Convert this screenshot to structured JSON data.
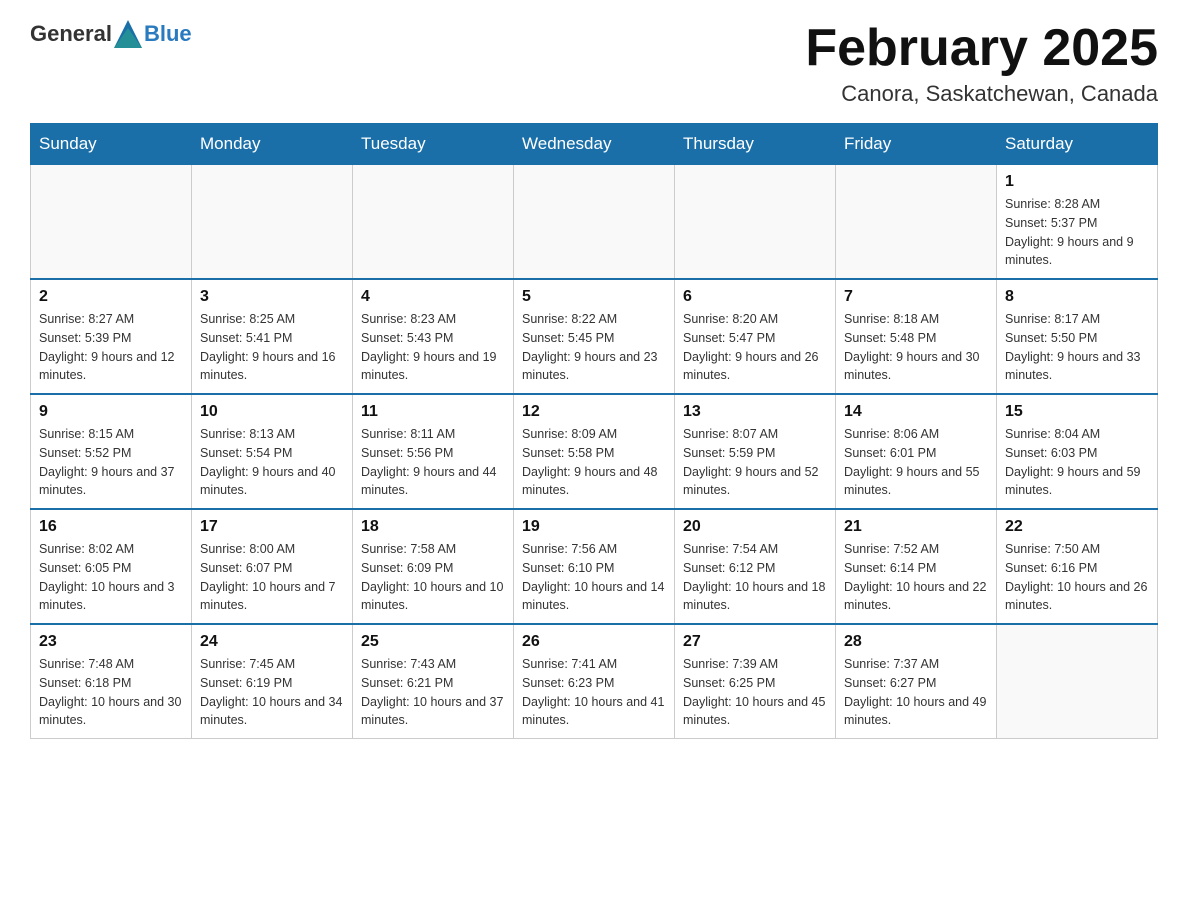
{
  "header": {
    "logo_text_general": "General",
    "logo_text_blue": "Blue",
    "month_title": "February 2025",
    "location": "Canora, Saskatchewan, Canada"
  },
  "days_of_week": [
    "Sunday",
    "Monday",
    "Tuesday",
    "Wednesday",
    "Thursday",
    "Friday",
    "Saturday"
  ],
  "weeks": [
    [
      {
        "day": "",
        "info": ""
      },
      {
        "day": "",
        "info": ""
      },
      {
        "day": "",
        "info": ""
      },
      {
        "day": "",
        "info": ""
      },
      {
        "day": "",
        "info": ""
      },
      {
        "day": "",
        "info": ""
      },
      {
        "day": "1",
        "info": "Sunrise: 8:28 AM\nSunset: 5:37 PM\nDaylight: 9 hours and 9 minutes."
      }
    ],
    [
      {
        "day": "2",
        "info": "Sunrise: 8:27 AM\nSunset: 5:39 PM\nDaylight: 9 hours and 12 minutes."
      },
      {
        "day": "3",
        "info": "Sunrise: 8:25 AM\nSunset: 5:41 PM\nDaylight: 9 hours and 16 minutes."
      },
      {
        "day": "4",
        "info": "Sunrise: 8:23 AM\nSunset: 5:43 PM\nDaylight: 9 hours and 19 minutes."
      },
      {
        "day": "5",
        "info": "Sunrise: 8:22 AM\nSunset: 5:45 PM\nDaylight: 9 hours and 23 minutes."
      },
      {
        "day": "6",
        "info": "Sunrise: 8:20 AM\nSunset: 5:47 PM\nDaylight: 9 hours and 26 minutes."
      },
      {
        "day": "7",
        "info": "Sunrise: 8:18 AM\nSunset: 5:48 PM\nDaylight: 9 hours and 30 minutes."
      },
      {
        "day": "8",
        "info": "Sunrise: 8:17 AM\nSunset: 5:50 PM\nDaylight: 9 hours and 33 minutes."
      }
    ],
    [
      {
        "day": "9",
        "info": "Sunrise: 8:15 AM\nSunset: 5:52 PM\nDaylight: 9 hours and 37 minutes."
      },
      {
        "day": "10",
        "info": "Sunrise: 8:13 AM\nSunset: 5:54 PM\nDaylight: 9 hours and 40 minutes."
      },
      {
        "day": "11",
        "info": "Sunrise: 8:11 AM\nSunset: 5:56 PM\nDaylight: 9 hours and 44 minutes."
      },
      {
        "day": "12",
        "info": "Sunrise: 8:09 AM\nSunset: 5:58 PM\nDaylight: 9 hours and 48 minutes."
      },
      {
        "day": "13",
        "info": "Sunrise: 8:07 AM\nSunset: 5:59 PM\nDaylight: 9 hours and 52 minutes."
      },
      {
        "day": "14",
        "info": "Sunrise: 8:06 AM\nSunset: 6:01 PM\nDaylight: 9 hours and 55 minutes."
      },
      {
        "day": "15",
        "info": "Sunrise: 8:04 AM\nSunset: 6:03 PM\nDaylight: 9 hours and 59 minutes."
      }
    ],
    [
      {
        "day": "16",
        "info": "Sunrise: 8:02 AM\nSunset: 6:05 PM\nDaylight: 10 hours and 3 minutes."
      },
      {
        "day": "17",
        "info": "Sunrise: 8:00 AM\nSunset: 6:07 PM\nDaylight: 10 hours and 7 minutes."
      },
      {
        "day": "18",
        "info": "Sunrise: 7:58 AM\nSunset: 6:09 PM\nDaylight: 10 hours and 10 minutes."
      },
      {
        "day": "19",
        "info": "Sunrise: 7:56 AM\nSunset: 6:10 PM\nDaylight: 10 hours and 14 minutes."
      },
      {
        "day": "20",
        "info": "Sunrise: 7:54 AM\nSunset: 6:12 PM\nDaylight: 10 hours and 18 minutes."
      },
      {
        "day": "21",
        "info": "Sunrise: 7:52 AM\nSunset: 6:14 PM\nDaylight: 10 hours and 22 minutes."
      },
      {
        "day": "22",
        "info": "Sunrise: 7:50 AM\nSunset: 6:16 PM\nDaylight: 10 hours and 26 minutes."
      }
    ],
    [
      {
        "day": "23",
        "info": "Sunrise: 7:48 AM\nSunset: 6:18 PM\nDaylight: 10 hours and 30 minutes."
      },
      {
        "day": "24",
        "info": "Sunrise: 7:45 AM\nSunset: 6:19 PM\nDaylight: 10 hours and 34 minutes."
      },
      {
        "day": "25",
        "info": "Sunrise: 7:43 AM\nSunset: 6:21 PM\nDaylight: 10 hours and 37 minutes."
      },
      {
        "day": "26",
        "info": "Sunrise: 7:41 AM\nSunset: 6:23 PM\nDaylight: 10 hours and 41 minutes."
      },
      {
        "day": "27",
        "info": "Sunrise: 7:39 AM\nSunset: 6:25 PM\nDaylight: 10 hours and 45 minutes."
      },
      {
        "day": "28",
        "info": "Sunrise: 7:37 AM\nSunset: 6:27 PM\nDaylight: 10 hours and 49 minutes."
      },
      {
        "day": "",
        "info": ""
      }
    ]
  ]
}
